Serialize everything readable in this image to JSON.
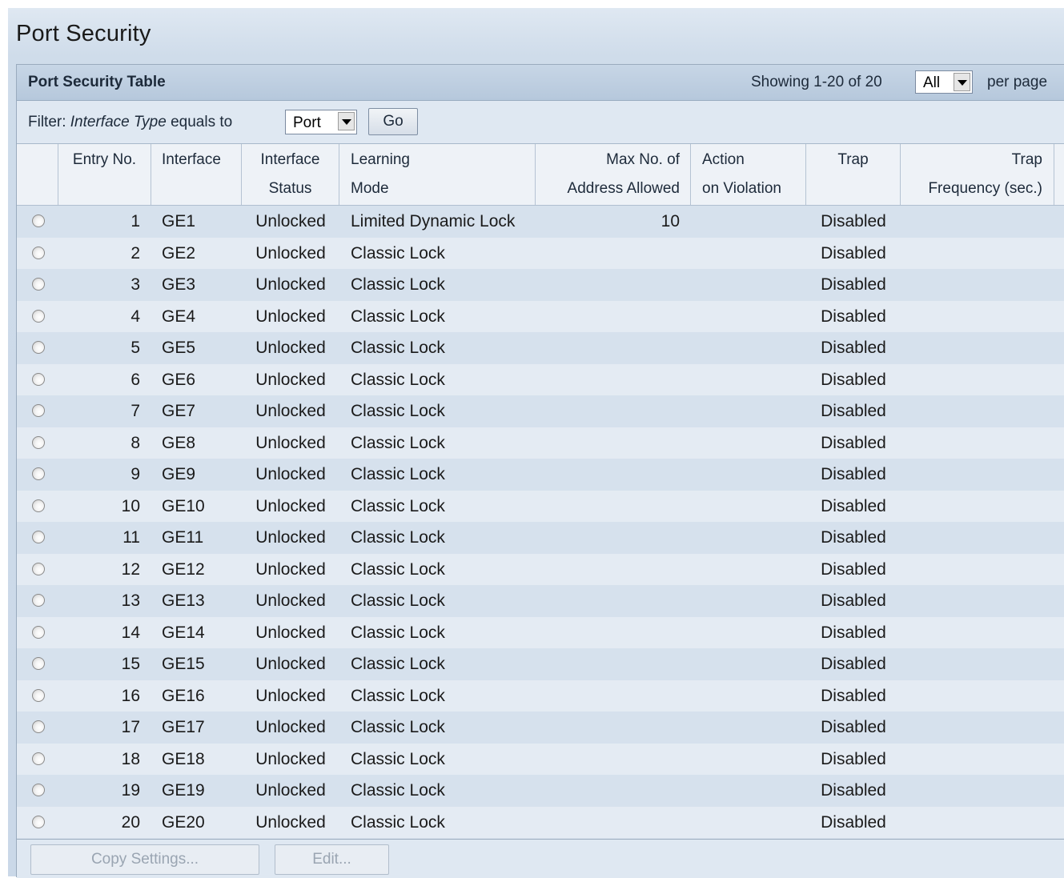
{
  "page": {
    "title": "Port Security"
  },
  "panel": {
    "title": "Port Security Table",
    "showing": "Showing 1-20 of 20",
    "per_page_value": "All",
    "per_page_label": "per page"
  },
  "filter": {
    "label": "Filter:",
    "field": "Interface Type",
    "operator": "equals to",
    "value": "Port",
    "go_label": "Go"
  },
  "columns": {
    "entry": "Entry No.",
    "interface": "Interface",
    "status_l1": "Interface",
    "status_l2": "Status",
    "mode_l1": "Learning",
    "mode_l2": "Mode",
    "max_l1": "Max No. of",
    "max_l2": "Address Allowed",
    "action_l1": "Action",
    "action_l2": "on Violation",
    "trap": "Trap",
    "freq_l1": "Trap",
    "freq_l2": "Frequency (sec.)"
  },
  "rows": [
    {
      "entry": "1",
      "interface": "GE1",
      "status": "Unlocked",
      "mode": "Limited Dynamic Lock",
      "max": "10",
      "action": "",
      "trap": "Disabled",
      "freq": ""
    },
    {
      "entry": "2",
      "interface": "GE2",
      "status": "Unlocked",
      "mode": "Classic Lock",
      "max": "",
      "action": "",
      "trap": "Disabled",
      "freq": ""
    },
    {
      "entry": "3",
      "interface": "GE3",
      "status": "Unlocked",
      "mode": "Classic Lock",
      "max": "",
      "action": "",
      "trap": "Disabled",
      "freq": ""
    },
    {
      "entry": "4",
      "interface": "GE4",
      "status": "Unlocked",
      "mode": "Classic Lock",
      "max": "",
      "action": "",
      "trap": "Disabled",
      "freq": ""
    },
    {
      "entry": "5",
      "interface": "GE5",
      "status": "Unlocked",
      "mode": "Classic Lock",
      "max": "",
      "action": "",
      "trap": "Disabled",
      "freq": ""
    },
    {
      "entry": "6",
      "interface": "GE6",
      "status": "Unlocked",
      "mode": "Classic Lock",
      "max": "",
      "action": "",
      "trap": "Disabled",
      "freq": ""
    },
    {
      "entry": "7",
      "interface": "GE7",
      "status": "Unlocked",
      "mode": "Classic Lock",
      "max": "",
      "action": "",
      "trap": "Disabled",
      "freq": ""
    },
    {
      "entry": "8",
      "interface": "GE8",
      "status": "Unlocked",
      "mode": "Classic Lock",
      "max": "",
      "action": "",
      "trap": "Disabled",
      "freq": ""
    },
    {
      "entry": "9",
      "interface": "GE9",
      "status": "Unlocked",
      "mode": "Classic Lock",
      "max": "",
      "action": "",
      "trap": "Disabled",
      "freq": ""
    },
    {
      "entry": "10",
      "interface": "GE10",
      "status": "Unlocked",
      "mode": "Classic Lock",
      "max": "",
      "action": "",
      "trap": "Disabled",
      "freq": ""
    },
    {
      "entry": "11",
      "interface": "GE11",
      "status": "Unlocked",
      "mode": "Classic Lock",
      "max": "",
      "action": "",
      "trap": "Disabled",
      "freq": ""
    },
    {
      "entry": "12",
      "interface": "GE12",
      "status": "Unlocked",
      "mode": "Classic Lock",
      "max": "",
      "action": "",
      "trap": "Disabled",
      "freq": ""
    },
    {
      "entry": "13",
      "interface": "GE13",
      "status": "Unlocked",
      "mode": "Classic Lock",
      "max": "",
      "action": "",
      "trap": "Disabled",
      "freq": ""
    },
    {
      "entry": "14",
      "interface": "GE14",
      "status": "Unlocked",
      "mode": "Classic Lock",
      "max": "",
      "action": "",
      "trap": "Disabled",
      "freq": ""
    },
    {
      "entry": "15",
      "interface": "GE15",
      "status": "Unlocked",
      "mode": "Classic Lock",
      "max": "",
      "action": "",
      "trap": "Disabled",
      "freq": ""
    },
    {
      "entry": "16",
      "interface": "GE16",
      "status": "Unlocked",
      "mode": "Classic Lock",
      "max": "",
      "action": "",
      "trap": "Disabled",
      "freq": ""
    },
    {
      "entry": "17",
      "interface": "GE17",
      "status": "Unlocked",
      "mode": "Classic Lock",
      "max": "",
      "action": "",
      "trap": "Disabled",
      "freq": ""
    },
    {
      "entry": "18",
      "interface": "GE18",
      "status": "Unlocked",
      "mode": "Classic Lock",
      "max": "",
      "action": "",
      "trap": "Disabled",
      "freq": ""
    },
    {
      "entry": "19",
      "interface": "GE19",
      "status": "Unlocked",
      "mode": "Classic Lock",
      "max": "",
      "action": "",
      "trap": "Disabled",
      "freq": ""
    },
    {
      "entry": "20",
      "interface": "GE20",
      "status": "Unlocked",
      "mode": "Classic Lock",
      "max": "",
      "action": "",
      "trap": "Disabled",
      "freq": ""
    }
  ],
  "footer": {
    "copy_label": "Copy Settings...",
    "edit_label": "Edit..."
  }
}
